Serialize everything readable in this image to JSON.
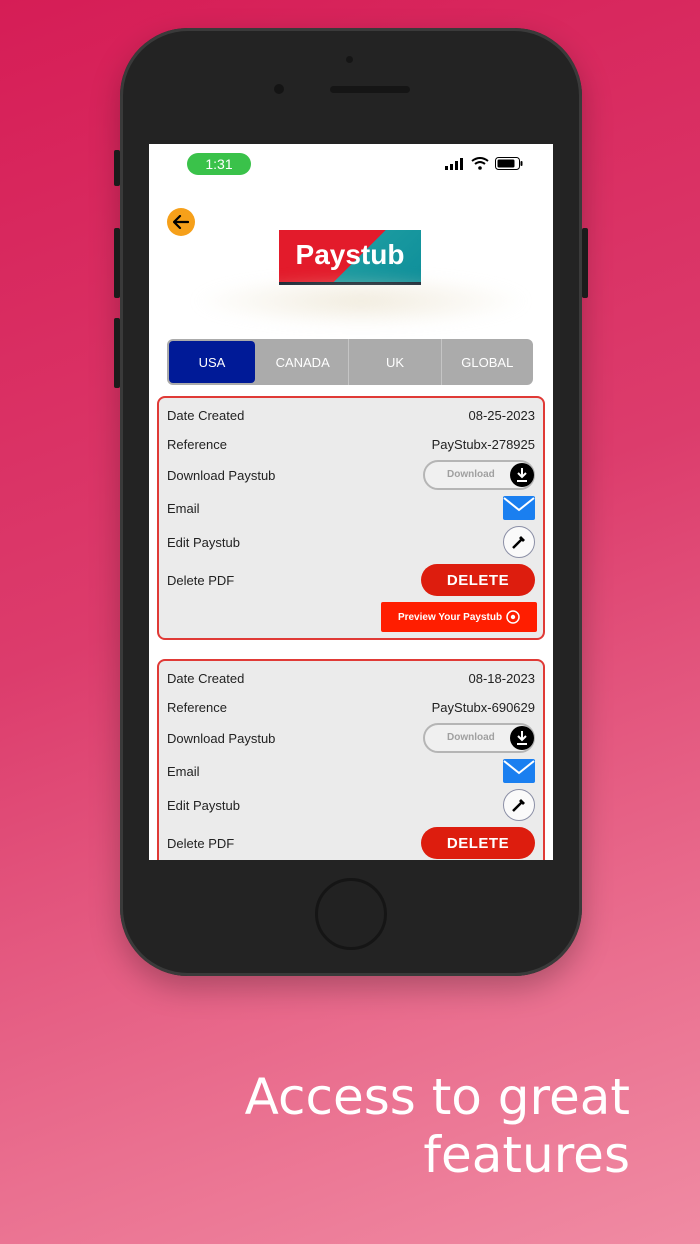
{
  "status_bar": {
    "time": "1:31"
  },
  "header": {
    "logo_text": "Paystub"
  },
  "tabs": [
    {
      "label": "USA",
      "active": true
    },
    {
      "label": "CANADA",
      "active": false
    },
    {
      "label": "UK",
      "active": false
    },
    {
      "label": "GLOBAL",
      "active": false
    }
  ],
  "labels": {
    "date_created": "Date Created",
    "reference": "Reference",
    "download_paystub": "Download Paystub",
    "email": "Email",
    "edit_paystub": "Edit Paystub",
    "delete_pdf": "Delete PDF",
    "download_button": "Download",
    "delete_button": "DELETE",
    "preview_button": "Preview Your Paystub"
  },
  "paystubs": [
    {
      "date": "08-25-2023",
      "reference": "PayStubx-278925"
    },
    {
      "date": "08-18-2023",
      "reference": "PayStubx-690629"
    }
  ],
  "tagline": {
    "line1": "Access to great",
    "line2": "features"
  },
  "colors": {
    "accent_red": "#dd1d0e",
    "tab_active": "#001a97",
    "background": "#d61d56"
  }
}
